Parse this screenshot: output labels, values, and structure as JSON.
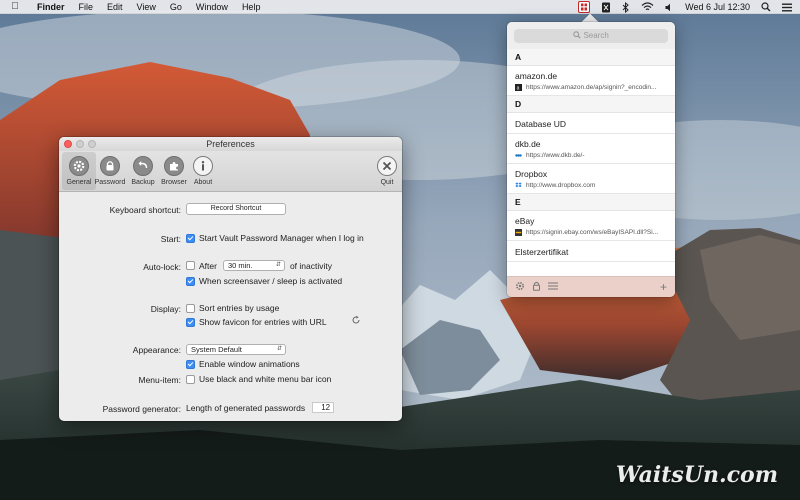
{
  "menubar": {
    "app_name": "Finder",
    "menus": [
      "File",
      "Edit",
      "View",
      "Go",
      "Window",
      "Help"
    ],
    "clock": "Wed 6 Jul  12:30"
  },
  "preferences": {
    "title": "Preferences",
    "toolbar": [
      {
        "label": "General",
        "icon": "gear-icon",
        "selected": true
      },
      {
        "label": "Password",
        "icon": "lock-icon"
      },
      {
        "label": "Backup",
        "icon": "backup-arrow-icon"
      },
      {
        "label": "Browser",
        "icon": "puzzle-icon"
      },
      {
        "label": "About",
        "icon": "info-icon"
      },
      {
        "label": "Quit",
        "icon": "close-circle-icon"
      }
    ],
    "keyboard_shortcut": {
      "label": "Keyboard shortcut:",
      "button": "Record Shortcut"
    },
    "start": {
      "label": "Start:",
      "option": "Start Vault Password Manager when I log in",
      "checked": true
    },
    "auto_lock": {
      "label": "Auto-lock:",
      "after_label": "After",
      "after_checked": false,
      "duration": "30 min.",
      "suffix": "of inactivity",
      "screensaver": "When screensaver / sleep is activated",
      "screensaver_checked": true
    },
    "display": {
      "label": "Display:",
      "sort": "Sort entries by usage",
      "sort_checked": false,
      "favicon": "Show favicon for entries with URL",
      "favicon_checked": true
    },
    "appearance": {
      "label": "Appearance:",
      "value": "System Default",
      "animations": "Enable window animations",
      "animations_checked": true
    },
    "menu_item": {
      "label": "Menu-item:",
      "option": "Use black and white menu bar icon",
      "checked": false
    },
    "password_generator": {
      "label": "Password generator:",
      "text": "Length of generated passwords",
      "value": "12"
    }
  },
  "vault": {
    "search_placeholder": "Search",
    "sections": [
      {
        "letter": "A",
        "entries": [
          {
            "name": "amazon.de",
            "url": "https://www.amazon.de/ap/signin?_encodin...",
            "favicon": "amazon"
          }
        ]
      },
      {
        "letter": "D",
        "entries": [
          {
            "name": "Database UD"
          },
          {
            "name": "dkb.de",
            "url": "https://www.dkb.de/-",
            "favicon": "dkb"
          },
          {
            "name": "Dropbox",
            "url": "http://www.dropbox.com",
            "favicon": "dropbox"
          }
        ]
      },
      {
        "letter": "E",
        "entries": [
          {
            "name": "eBay",
            "url": "https://signin.ebay.com/ws/eBayISAPI.dll?Si...",
            "favicon": "ebay"
          },
          {
            "name": "Elsterzertifikat"
          }
        ]
      }
    ]
  },
  "watermark": "WaitsUn.com",
  "colors": {
    "accent": "#3d8df5",
    "close": "#fc605c",
    "vault_red": "#c62828"
  }
}
